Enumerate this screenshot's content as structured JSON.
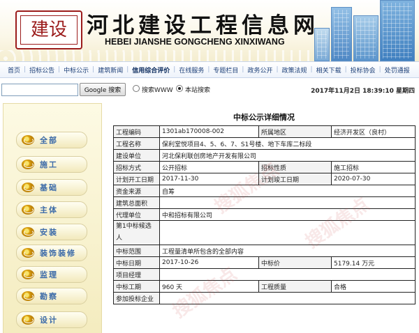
{
  "header": {
    "seal_text": "建设",
    "title": "河北建设工程信息网",
    "subtitle": "HEBEI JIANSHE GONGCHENG XINXIWANG"
  },
  "nav": {
    "items": [
      "首页",
      "招标公告",
      "中标公示",
      "建筑新闻",
      "信用综合评价",
      "在线服务",
      "专题栏目",
      "政务公开",
      "政策法规",
      "相关下载",
      "投标协会",
      "处罚通报"
    ],
    "active": "信用综合评价"
  },
  "search": {
    "value": "",
    "button_label": "Google 搜索",
    "option_www": "搜索WWW",
    "option_site": "本站搜索",
    "selected": "本站搜索",
    "datetime": "2017年11月2日 18:39:10 星期四"
  },
  "sidebar": {
    "items": [
      {
        "label": "全部"
      },
      {
        "label": "施工"
      },
      {
        "label": "基础"
      },
      {
        "label": "主体"
      },
      {
        "label": "安装"
      },
      {
        "label": "装饰装修"
      },
      {
        "label": "监理"
      },
      {
        "label": "勘察"
      },
      {
        "label": "设计"
      }
    ]
  },
  "detail": {
    "title": "中标公示详细情况",
    "labels": {
      "code": "工程编码",
      "area": "所属地区",
      "name": "工程名称",
      "owner": "建设单位",
      "bid_method": "招标方式",
      "bid_nature": "招标性质",
      "start": "计划开工日期",
      "end": "计划竣工日期",
      "funds": "资金来源",
      "floor_area": "建筑总面积",
      "agent": "代理单位",
      "candidate": "第1中标候选人",
      "scope": "中标范围",
      "win_date": "中标日期",
      "price": "中标价",
      "manager": "项目经理",
      "duration": "中标工期",
      "quality": "工程质量",
      "other_bidders": "参加投标企业"
    },
    "values": {
      "code": "1301ab170008-002",
      "area": "经济开发区（良村）",
      "name": "保利堂悦项目4、5、6、7、S1号楼、地下车库二标段",
      "owner": "河北保利联创房地产开发有限公司",
      "bid_method": "公开招标",
      "bid_nature": "施工招标",
      "start": "2017-11-30",
      "end": "2020-07-30",
      "funds": "自筹",
      "floor_area": "",
      "agent": "中和招标有限公司",
      "candidate": "",
      "scope": "工程量清单所包含的全部内容",
      "win_date": "2017-10-26",
      "price": "5179.14 万元",
      "manager": "",
      "duration": "960 天",
      "quality": "合格",
      "other_bidders": ""
    }
  }
}
